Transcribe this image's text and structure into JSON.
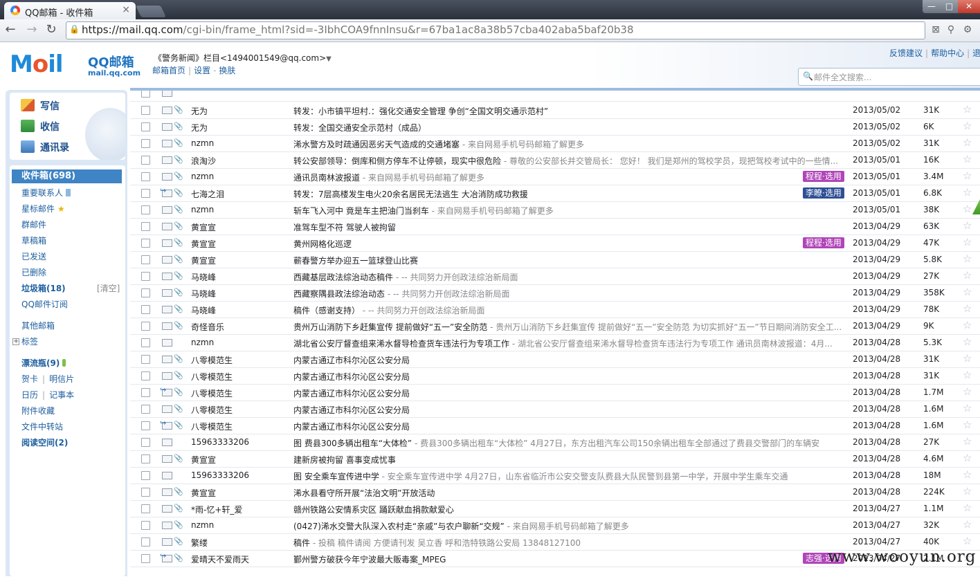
{
  "browser": {
    "tab_title": "QQ邮箱 - 收件箱",
    "tab_close": "×",
    "url_host": "https://mail.qq.com",
    "url_path": "/cgi-bin/frame_html?sid=-3IbhCOA9fnnInsu&r=67ba1ac8a38b57cba402aba5baf20b38",
    "win_min": "—",
    "win_max": "□",
    "win_close": "✕"
  },
  "header": {
    "logo_mail": "Mail",
    "logo_qq": "QQ邮箱",
    "logo_domain": "mail.qq.com",
    "account": "《警务新闻》栏目<1494001549@qq.com>",
    "account_caret": "▼",
    "links": [
      "邮箱首页",
      "设置",
      "换肤"
    ],
    "top_links": [
      "反馈建议",
      "帮助中心",
      "退"
    ],
    "search_placeholder": "邮件全文搜索..."
  },
  "actions": {
    "write": "写信",
    "receive": "收信",
    "contacts": "通讯录"
  },
  "folders": {
    "inbox": "收件箱(698)",
    "important": "重要联系人",
    "starred": "星标邮件",
    "group": "群邮件",
    "drafts": "草稿箱",
    "sent": "已发送",
    "deleted": "已删除",
    "spam": "垃圾箱(18)",
    "spam_clear": "[清空]",
    "subscription": "QQ邮件订阅",
    "other_mail": "其他邮箱",
    "tags_toggle": "+",
    "tags": "标签",
    "bottle": "漂流瓶(9)",
    "card": "贺卡",
    "postcard": "明信片",
    "calendar": "日历",
    "notes": "记事本",
    "attachments": "附件收藏",
    "transfer": "文件中转站",
    "reading": "阅读空间(2)"
  },
  "emails": [
    {
      "sender": "无为",
      "subject": "转发：小市镇平坦村.：强化交通安全管理 争创“全国文明交通示范村”",
      "preview": "",
      "date": "2013/05/02",
      "size": "31K",
      "fwd": false,
      "clip": true,
      "tag": ""
    },
    {
      "sender": "无为",
      "subject": "转发：全国交通安全示范村（成品）",
      "preview": "",
      "date": "2013/05/02",
      "size": "6K",
      "fwd": false,
      "clip": true,
      "tag": ""
    },
    {
      "sender": "nzmn",
      "subject": "浠水警方及时疏通因恶劣天气造成的交通堵塞",
      "preview": " - 来自网易手机号码邮箱了解更多",
      "date": "2013/05/02",
      "size": "31K",
      "fwd": false,
      "clip": true,
      "tag": ""
    },
    {
      "sender": "浪淘沙",
      "subject": "转公安部领导：倒库和侧方停车不让停顿，现实中很危险",
      "preview": " - 尊敬的公安部长并交管局长： 您好！ 我们是郑州的驾校学员，现把驾校考试中的一些情...",
      "date": "2013/05/01",
      "size": "16K",
      "fwd": false,
      "clip": true,
      "tag": ""
    },
    {
      "sender": "nzmn",
      "subject": "通讯员南林波报道",
      "preview": " - 来自网易手机号码邮箱了解更多",
      "date": "2013/05/01",
      "size": "3.4M",
      "fwd": false,
      "clip": true,
      "tag": "程程·选用",
      "tag_color": "purple"
    },
    {
      "sender": "七海之泪",
      "subject": "转发：7层高楼发生电火20余名居民无法逃生 大冶消防成功救援",
      "preview": "",
      "date": "2013/05/01",
      "size": "6.8K",
      "fwd": true,
      "clip": true,
      "tag": "李瞭·选用",
      "tag_color": "navy"
    },
    {
      "sender": "nzmn",
      "subject": "斩车飞入河中 竟是车主把油门当刹车",
      "preview": " - 来自网易手机号码邮箱了解更多",
      "date": "2013/05/01",
      "size": "38K",
      "fwd": false,
      "clip": true,
      "tag": ""
    },
    {
      "sender": "黄宣宣",
      "subject": "准驾车型不符 驾驶人被拘留",
      "preview": "",
      "date": "2013/04/29",
      "size": "63K",
      "fwd": false,
      "clip": true,
      "tag": ""
    },
    {
      "sender": "黄宣宣",
      "subject": "黄州网格化巡逻",
      "preview": "",
      "date": "2013/04/29",
      "size": "47K",
      "fwd": false,
      "clip": true,
      "tag": "程程·选用",
      "tag_color": "purple"
    },
    {
      "sender": "黄宣宣",
      "subject": "蕲春警方举办迎五一篮球登山比赛",
      "preview": "",
      "date": "2013/04/29",
      "size": "5.8K",
      "fwd": false,
      "clip": true,
      "tag": ""
    },
    {
      "sender": "马晓峰",
      "subject": "西藏基层政法综治动态稿件",
      "preview": " -  --     共同努力开创政法综治新局面",
      "date": "2013/04/29",
      "size": "27K",
      "fwd": false,
      "clip": true,
      "tag": ""
    },
    {
      "sender": "马晓峰",
      "subject": "西藏察隅县政法综治动态",
      "preview": " -  --     共同努力开创政法综治新局面",
      "date": "2013/04/29",
      "size": "358K",
      "fwd": false,
      "clip": true,
      "tag": ""
    },
    {
      "sender": "马晓峰",
      "subject": "稿件（感谢支持）",
      "preview": " -  --     共同努力开创政法综治新局面",
      "date": "2013/04/29",
      "size": "78K",
      "fwd": false,
      "clip": true,
      "tag": ""
    },
    {
      "sender": "奇怪音乐",
      "subject": "贵州万山消防下乡赶集宣传 提前做好“五一”安全防范",
      "preview": " - 贵州万山消防下乡赶集宣传 提前做好“五一”安全防范 为切实抓好“五一”节日期间消防安全工...",
      "date": "2013/04/29",
      "size": "9K",
      "fwd": false,
      "clip": true,
      "tag": ""
    },
    {
      "sender": "nzmn",
      "subject": "湖北省公安厅督查组来浠水督导检查货车违法行为专项工作",
      "preview": " - 湖北省公安厅督查组来浠水督导检查货车违法行为专项工作   通讯员南林波报道：4月...",
      "date": "2013/04/28",
      "size": "5.3K",
      "fwd": false,
      "clip": false,
      "tag": ""
    },
    {
      "sender": "八零模范生",
      "subject": "内蒙古通辽市科尔沁区公安分局",
      "preview": "",
      "date": "2013/04/28",
      "size": "31K",
      "fwd": false,
      "clip": true,
      "tag": ""
    },
    {
      "sender": "八零模范生",
      "subject": "内蒙古通辽市科尔沁区公安分局",
      "preview": "",
      "date": "2013/04/28",
      "size": "31K",
      "fwd": false,
      "clip": true,
      "tag": ""
    },
    {
      "sender": "八零模范生",
      "subject": "内蒙古通辽市科尔沁区公安分局",
      "preview": "",
      "date": "2013/04/28",
      "size": "1.7M",
      "fwd": true,
      "clip": true,
      "tag": ""
    },
    {
      "sender": "八零模范生",
      "subject": "内蒙古通辽市科尔沁区公安分局",
      "preview": "",
      "date": "2013/04/28",
      "size": "1.6M",
      "fwd": false,
      "clip": true,
      "tag": ""
    },
    {
      "sender": "八零模范生",
      "subject": "内蒙古通辽市科尔沁区公安分局",
      "preview": "",
      "date": "2013/04/28",
      "size": "1.6M",
      "fwd": true,
      "clip": true,
      "tag": ""
    },
    {
      "sender": "15963333206",
      "subject": "图 费县300多辆出租车“大体检”",
      "preview": " - 费县300多辆出租车“大体检” 4月27日，东方出租汽车公司150余辆出租车全部通过了费县交警部门的车辆安",
      "date": "2013/04/28",
      "size": "27K",
      "fwd": false,
      "clip": false,
      "tag": ""
    },
    {
      "sender": "黄宣宣",
      "subject": "建新房被拘留 喜事变成忧事",
      "preview": "",
      "date": "2013/04/28",
      "size": "4.6M",
      "fwd": false,
      "clip": true,
      "tag": ""
    },
    {
      "sender": "15963333206",
      "subject": "图  安全乘车宣传进中学",
      "preview": " - 安全乘车宣传进中学 4月27日，山东省临沂市公安交警支队费县大队民警到县第一中学，开展中学生乘车交通",
      "date": "2013/04/28",
      "size": "18M",
      "fwd": false,
      "clip": false,
      "tag": ""
    },
    {
      "sender": "黄宣宣",
      "subject": "浠水县看守所开展“法治文明”开放活动",
      "preview": "",
      "date": "2013/04/28",
      "size": "224K",
      "fwd": false,
      "clip": true,
      "tag": ""
    },
    {
      "sender": "*雨-忆+轩_爱",
      "subject": "赣州铁路公安情系灾区 踊跃献血捐款献爱心",
      "preview": "",
      "date": "2013/04/27",
      "size": "1.1M",
      "fwd": false,
      "clip": true,
      "tag": ""
    },
    {
      "sender": "nzmn",
      "subject": "(0427)浠水交警大队深入农村走“亲戚”与农户聊新“交规”",
      "preview": " - 来自网易手机号码邮箱了解更多",
      "date": "2013/04/27",
      "size": "32K",
      "fwd": false,
      "clip": true,
      "tag": ""
    },
    {
      "sender": "繁缕",
      "subject": "稿件",
      "preview": " - 投稿 稿件请阅  方便请刊发 吴立香 呼和浩特铁路公安局 13848127100",
      "date": "2013/04/27",
      "size": "40K",
      "fwd": false,
      "clip": true,
      "tag": ""
    },
    {
      "sender": "爱晴天不爱雨天",
      "subject": "鄞州警方破获今年宁波最大贩毒案_MPEG",
      "preview": "",
      "date": "2013/04/27",
      "size": "2.1M",
      "fwd": true,
      "clip": true,
      "tag": "志强·选用",
      "tag_color": "purple"
    }
  ],
  "watermark": "www.wooyun.org"
}
